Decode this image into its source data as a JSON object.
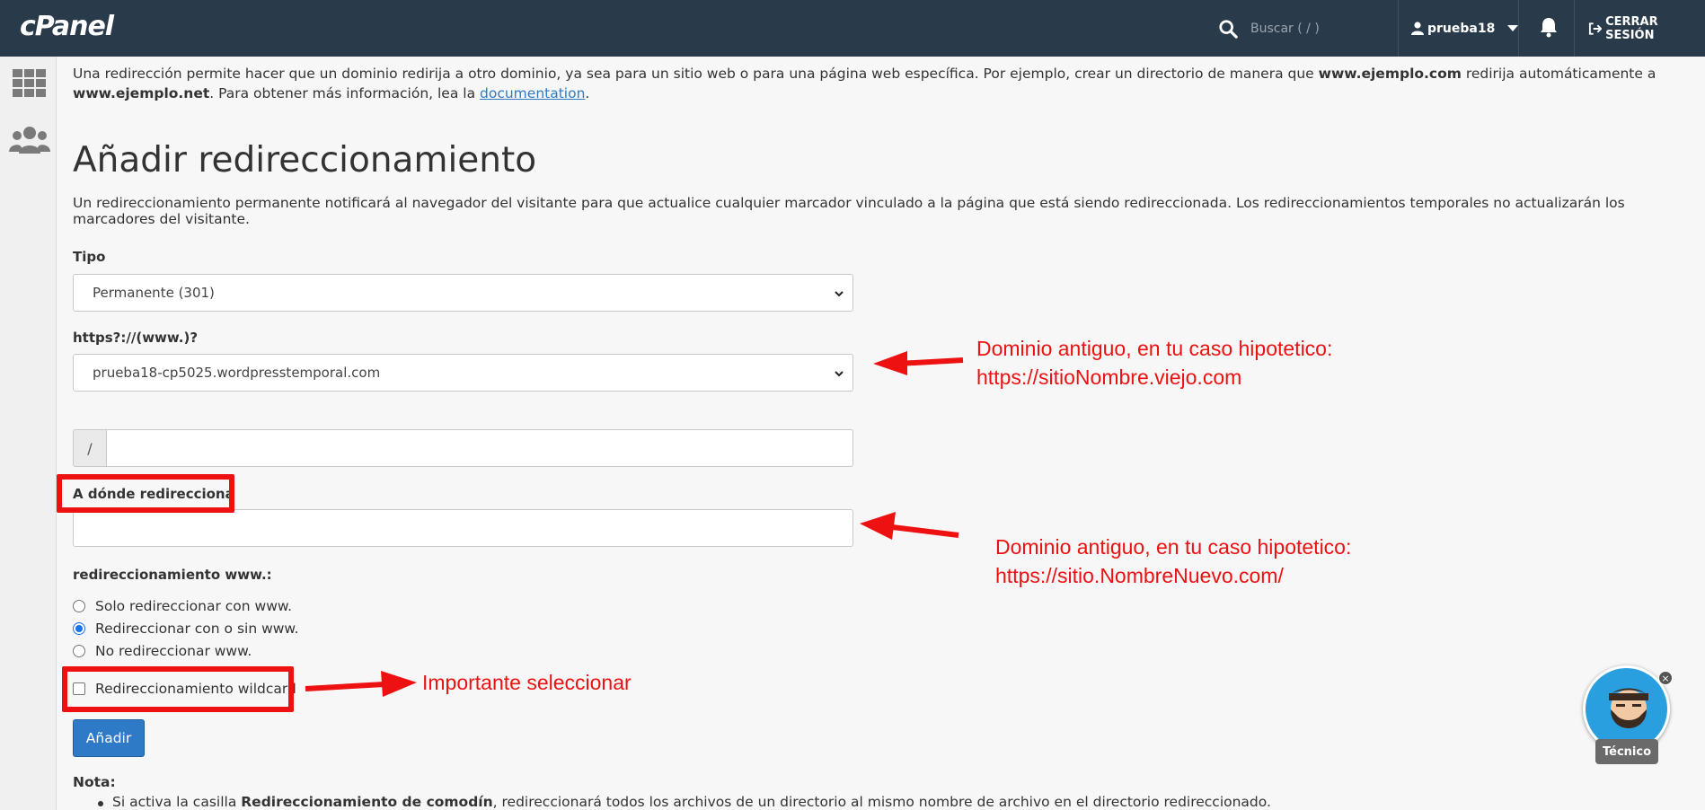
{
  "header": {
    "logo": "cPanel",
    "search_placeholder": "Buscar ( / )",
    "username": "prueba18",
    "logout_label": "CERRAR SESIÓN"
  },
  "intro": {
    "part1": "Una redirección permite hacer que un dominio redirija a otro dominio, ya sea para un sitio web o para una página web específica. Por ejemplo, crear un directorio de manera que ",
    "example1": "www.ejemplo.com",
    "part2": " redirija automáticamente a ",
    "example2": "www.ejemplo.net",
    "part3": ". Para obtener más información, lea la ",
    "link": "documentation",
    "part4": "."
  },
  "form": {
    "title": "Añadir redireccionamiento",
    "description": "Un redireccionamiento permanente notificará al navegador del visitante para que actualice cualquier marcador vinculado a la página que está siendo redireccionada. Los redireccionamientos temporales no actualizarán los marcadores del visitante.",
    "type_label": "Tipo",
    "type_value": "Permanente (301)",
    "domain_label": "https?://(www.)?",
    "domain_value": "prueba18-cp5025.wordpresstemporal.com",
    "path_prefix": "/",
    "target_label": "A dónde redirecciona",
    "www_label": "redireccionamiento www.:",
    "www_options": [
      {
        "label": "Solo redireccionar con www.",
        "checked": false
      },
      {
        "label": "Redireccionar con o sin www.",
        "checked": true
      },
      {
        "label": "No redireccionar www.",
        "checked": false
      }
    ],
    "wildcard_label": "Redireccionamiento wildcard",
    "add_button": "Añadir",
    "note_title": "Nota:",
    "note_part1": "Si activa la casilla ",
    "note_bold": "Redireccionamiento de comodín",
    "note_part2": ", redireccionará todos los archivos de un directorio al mismo nombre de archivo en el directorio redireccionado."
  },
  "annotations": {
    "domain_old_line1": "Dominio antiguo, en tu caso hipotetico:",
    "domain_old_line2": "https://sitioNombre.viejo.com",
    "domain_new_line1": "Dominio antiguo, en tu caso hipotetico:",
    "domain_new_line2": "https://sitio.NombreNuevo.com/",
    "wildcard_note": "Importante seleccionar",
    "color": "#ee1111"
  },
  "chat_widget": {
    "label": "Técnico",
    "close": "×"
  },
  "colors": {
    "header_bg": "#293a4a",
    "primary": "#2f7ac6"
  }
}
